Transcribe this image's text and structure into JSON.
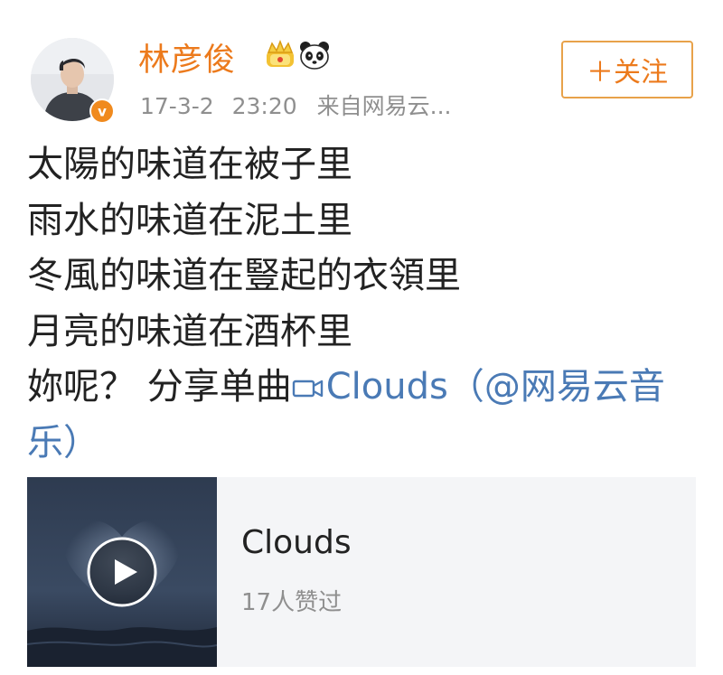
{
  "post": {
    "username": "林彦俊",
    "date": "17-3-2",
    "time": "23:20",
    "source": "来自网易云...",
    "follow_label": "＋关注",
    "badges": [
      "crown-icon",
      "panda-icon",
      "verified-v-icon"
    ],
    "lines": [
      "太陽的味道在被子里",
      "雨水的味道在泥土里",
      "冬風的味道在豎起的衣領里",
      "月亮的味道在酒杯里"
    ],
    "last_line_prefix": "妳呢？ 分享单曲",
    "song_link": "Clouds（@网易云音乐）"
  },
  "music_card": {
    "title": "Clouds",
    "likes": "17人赞过"
  },
  "colors": {
    "username": "#ec7a1c",
    "follow_border": "#e8a24a",
    "link": "#4a7ab5",
    "meta": "#8f8f8f",
    "card_bg": "#f4f5f7"
  }
}
